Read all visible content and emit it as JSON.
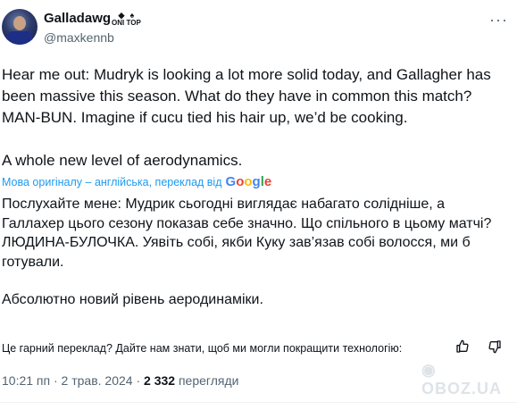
{
  "user": {
    "display_name": "Galladawg",
    "badge_text": "ONI TOP",
    "handle": "@maxkennb"
  },
  "tweet": {
    "original_paragraphs": [
      "Hear me out: Mudryk is looking a lot more solid today, and Gallagher has been massive this season. What do they have in common this match? MAN-BUN. Imagine if cucu tied his hair up, we’d be cooking.",
      "A whole new level of aerodynamics."
    ],
    "translation_note": "Мова оригіналу – англійська, переклад від",
    "translation_provider": "Google",
    "translated_paragraphs": [
      "Послухайте мене: Мудрик сьогодні виглядає набагато солідніше, а Галлахер цього сезону показав себе значно. Що спільного в цьому матчі? ЛЮДИНА-БУЛОЧКА. Уявіть собі, якби Куку зав’язав собі волосся, ми б готували.",
      "Абсолютно новий рівень аеродинаміки."
    ],
    "feedback_prompt": "Це гарний переклад? Дайте нам знати, щоб ми могли покращити технологію:",
    "time": "10:21 пп",
    "date": "2 трав. 2024",
    "views_count": "2 332",
    "views_label": "перегляди"
  },
  "watermark": "OBOZ.UA",
  "icons": [
    "more-dots-icon",
    "thumbs-up-icon",
    "thumbs-down-icon",
    "badge-icon"
  ]
}
